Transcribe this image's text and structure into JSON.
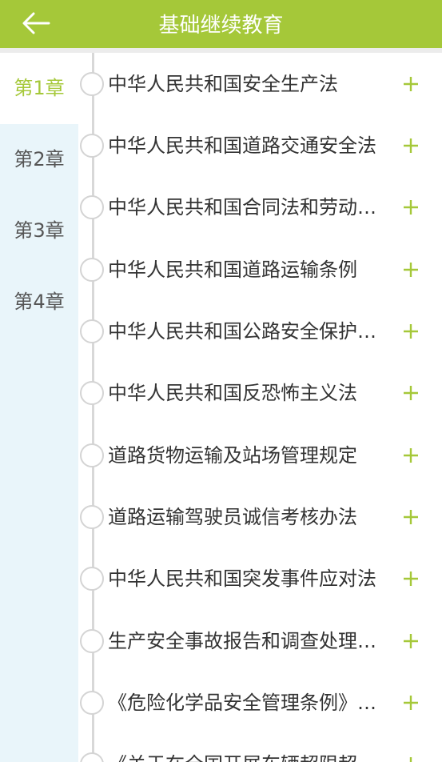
{
  "header": {
    "title": "基础继续教育",
    "back_icon": "arrow-left-icon"
  },
  "colors": {
    "accent": "#a5c839",
    "sidebar_bg": "#e9f5fa",
    "text": "#333333"
  },
  "chapters": [
    {
      "label": "第1章",
      "active": true
    },
    {
      "label": "第2章",
      "active": false
    },
    {
      "label": "第3章",
      "active": false
    },
    {
      "label": "第4章",
      "active": false
    }
  ],
  "items": [
    {
      "label": "中华人民共和国安全生产法",
      "icon": "plus-icon"
    },
    {
      "label": "中华人民共和国道路交通安全法",
      "icon": "plus-icon"
    },
    {
      "label": "中华人民共和国合同法和劳动合同法",
      "icon": "plus-icon"
    },
    {
      "label": "中华人民共和国道路运输条例",
      "icon": "plus-icon"
    },
    {
      "label": "中华人民共和国公路安全保护条例",
      "icon": "plus-icon"
    },
    {
      "label": "中华人民共和国反恐怖主义法",
      "icon": "plus-icon"
    },
    {
      "label": "道路货物运输及站场管理规定",
      "icon": "plus-icon"
    },
    {
      "label": "道路运输驾驶员诚信考核办法",
      "icon": "plus-icon"
    },
    {
      "label": "中华人民共和国突发事件应对法",
      "icon": "plus-icon"
    },
    {
      "label": "生产安全事故报告和调查处理条例",
      "icon": "plus-icon"
    },
    {
      "label": "《危险化学品安全管理条例》摘要",
      "icon": "plus-icon"
    },
    {
      "label": "《关于在全国开展车辆超限超载治理",
      "icon": "plus-icon"
    }
  ]
}
